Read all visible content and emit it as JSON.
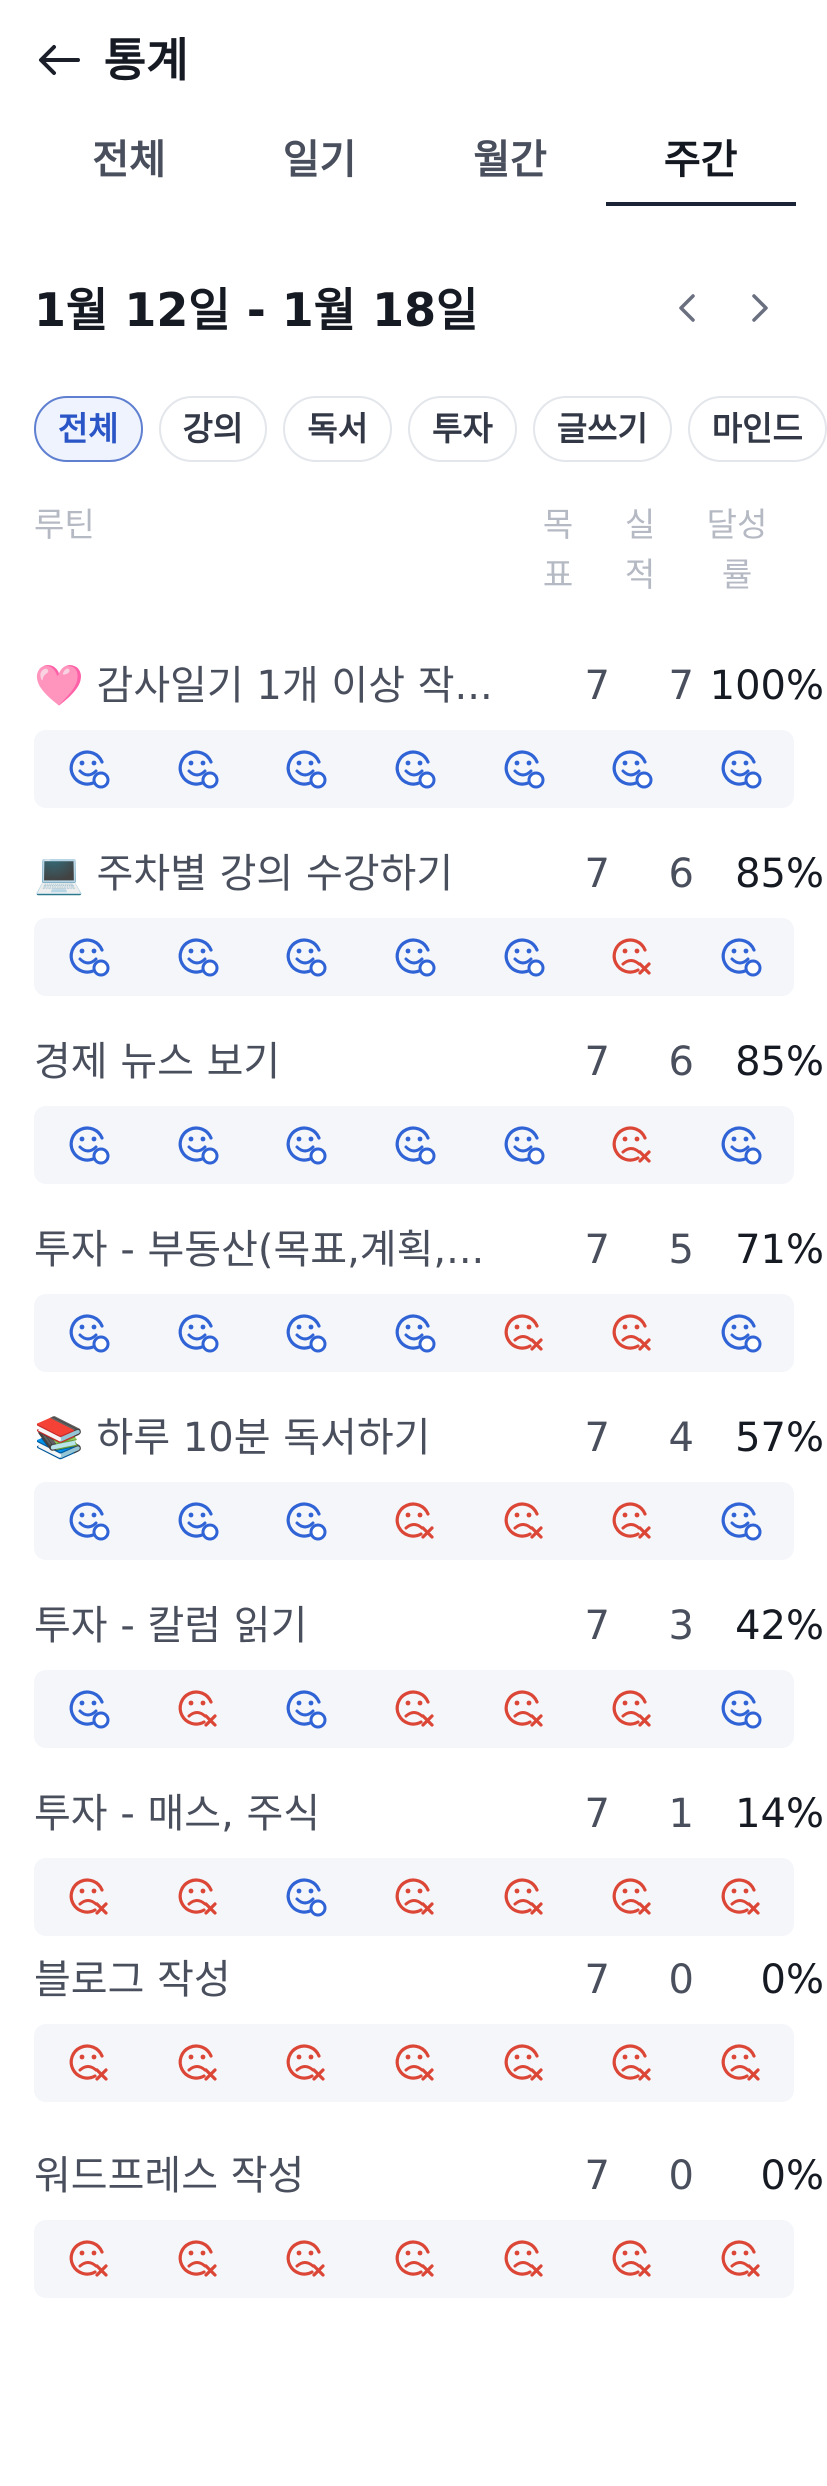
{
  "header": {
    "title": "통계"
  },
  "tabs": [
    {
      "label": "전체",
      "active": false
    },
    {
      "label": "일기",
      "active": false
    },
    {
      "label": "월간",
      "active": false
    },
    {
      "label": "주간",
      "active": true
    }
  ],
  "range": {
    "label": "1월 12일 - 1월 18일"
  },
  "chips": [
    "전체",
    "강의",
    "독서",
    "투자",
    "글쓰기",
    "마인드"
  ],
  "columns": {
    "routine": "루틴",
    "goal": "목표",
    "done": "실적",
    "rate": "달성률"
  },
  "colors": {
    "success": "#2f63d6",
    "fail": "#dc4636",
    "accent": "#2a55c7"
  },
  "routines": [
    {
      "name": "🩷 감사일기 1개 이상 작...",
      "goal": "7",
      "done": "7",
      "rate": "100%",
      "days": [
        1,
        1,
        1,
        1,
        1,
        1,
        1
      ]
    },
    {
      "name": "💻 주차별 강의 수강하기",
      "goal": "7",
      "done": "6",
      "rate": "85%",
      "days": [
        1,
        1,
        1,
        1,
        1,
        0,
        1
      ]
    },
    {
      "name": "경제 뉴스 보기",
      "goal": "7",
      "done": "6",
      "rate": "85%",
      "days": [
        1,
        1,
        1,
        1,
        1,
        0,
        1
      ]
    },
    {
      "name": "투자 - 부동산(목표,계획,...",
      "goal": "7",
      "done": "5",
      "rate": "71%",
      "days": [
        1,
        1,
        1,
        1,
        0,
        0,
        1
      ]
    },
    {
      "name": "📚 하루 10분 독서하기",
      "goal": "7",
      "done": "4",
      "rate": "57%",
      "days": [
        1,
        1,
        1,
        0,
        0,
        0,
        1
      ]
    },
    {
      "name": "투자 - 칼럼 읽기",
      "goal": "7",
      "done": "3",
      "rate": "42%",
      "days": [
        1,
        0,
        1,
        0,
        0,
        0,
        1
      ]
    },
    {
      "name": "투자 - 매스, 주식",
      "goal": "7",
      "done": "1",
      "rate": "14%",
      "days": [
        0,
        0,
        1,
        0,
        0,
        0,
        0
      ]
    },
    {
      "name": "블로그 작성",
      "goal": "7",
      "done": "0",
      "rate": "0%",
      "days": [
        0,
        0,
        0,
        0,
        0,
        0,
        0
      ]
    },
    {
      "name": "워드프레스 작성",
      "goal": "7",
      "done": "0",
      "rate": "0%",
      "days": [
        0,
        0,
        0,
        0,
        0,
        0,
        0
      ]
    }
  ]
}
